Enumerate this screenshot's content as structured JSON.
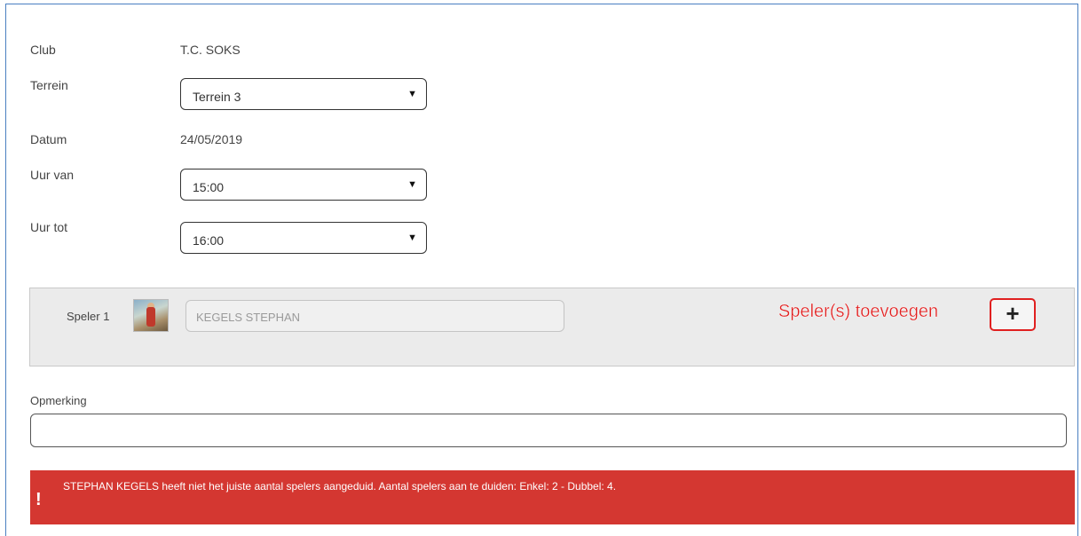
{
  "form": {
    "club_label": "Club",
    "club_value": "T.C. SOKS",
    "terrein_label": "Terrein",
    "terrein_value": "Terrein 3",
    "datum_label": "Datum",
    "datum_value": "24/05/2019",
    "uur_van_label": "Uur van",
    "uur_van_value": "15:00",
    "uur_tot_label": "Uur tot",
    "uur_tot_value": "16:00",
    "caret": "▼"
  },
  "players": {
    "player1_label": "Speler 1",
    "player1_name": "KEGELS STEPHAN",
    "add_annotation": "Speler(s) toevoegen",
    "add_symbol": "+",
    "add_icon": "plus-icon"
  },
  "remark": {
    "label": "Opmerking",
    "value": ""
  },
  "alert": {
    "icon": "!",
    "message": "STEPHAN KEGELS heeft niet het juiste aantal spelers aangeduid. Aantal spelers aan te duiden: Enkel: 2 - Dubbel: 4.",
    "color": "#d43731"
  }
}
